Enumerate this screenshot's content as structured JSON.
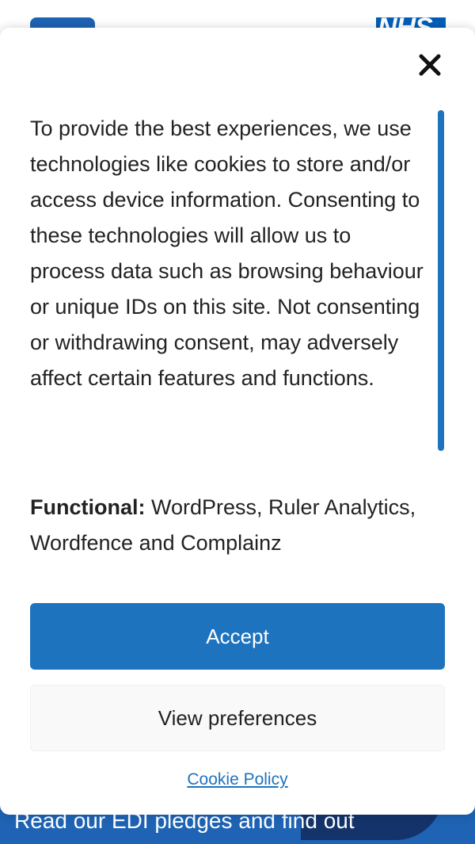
{
  "background": {
    "logo_text": "NHS",
    "footer_text": "Read our EDI pledges and find out"
  },
  "consent": {
    "close_icon": "close-icon",
    "message": "To provide the best experiences, we use technologies like cookies to store and/or access device information. Consenting to these technologies will allow us to process data such as browsing behaviour or unique IDs on this site. Not consenting or withdrawing consent, may adversely affect certain features and functions.",
    "functional_label": "Functional:",
    "functional_value": "WordPress, Ruler Analytics, Wordfence and Complainz",
    "accept_label": "Accept",
    "preferences_label": "View preferences",
    "policy_link": "Cookie Policy"
  },
  "colors": {
    "accent": "#1e73be",
    "text": "#222222",
    "footer_band": "#1e63b4"
  }
}
